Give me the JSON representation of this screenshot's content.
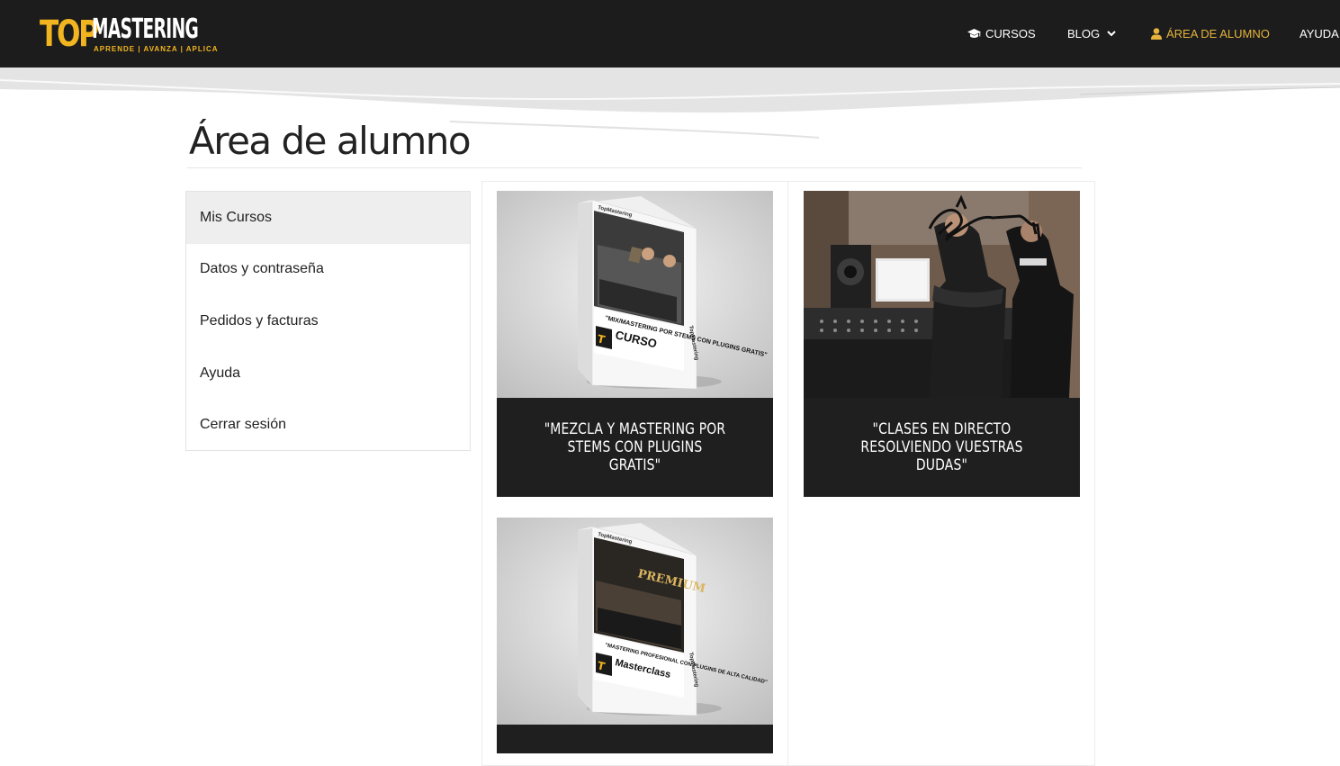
{
  "header": {
    "logo_main": "TOP",
    "logo_secondary": "MASTERING",
    "logo_tagline": "APRENDE | AVANZA | APLICA",
    "nav": [
      {
        "label": "CURSOS",
        "icon": "graduation-cap-icon"
      },
      {
        "label": "BLOG",
        "icon": "chevron-down-icon"
      },
      {
        "label": "ÁREA DE ALUMNO",
        "icon": "user-icon",
        "active": true
      },
      {
        "label": "AYUDA"
      }
    ]
  },
  "page": {
    "title": "Área de alumno"
  },
  "sidebar": {
    "items": [
      {
        "label": "Mis Cursos",
        "active": true
      },
      {
        "label": "Datos y contraseña"
      },
      {
        "label": "Pedidos y facturas"
      },
      {
        "label": "Ayuda"
      },
      {
        "label": "Cerrar sesión"
      }
    ]
  },
  "courses": [
    {
      "title": "\"MEZCLA Y MASTERING POR STEMS CON PLUGINS GRATIS\"",
      "box_label": "\"MIX/MASTERING POR STEMS CON PLUGINS GRATIS\"",
      "box_type": "CURSO",
      "box_brand": "TopMastering"
    },
    {
      "title": "\"CLASES EN DIRECTO RESOLVIENDO VUESTRAS DUDAS\""
    },
    {
      "title": "",
      "box_label": "\"MASTERING PROFESIONAL CON PLUGINS DE ALTA CALIDAD\"",
      "box_type": "Masterclass",
      "box_brand": "TopMastering",
      "box_badge": "PREMIUM"
    }
  ],
  "colors": {
    "topbar": "#1c1c1c",
    "accent": "#e5b33d",
    "caption_bg": "#1f1f1f",
    "active_item": "#eeeeee"
  }
}
